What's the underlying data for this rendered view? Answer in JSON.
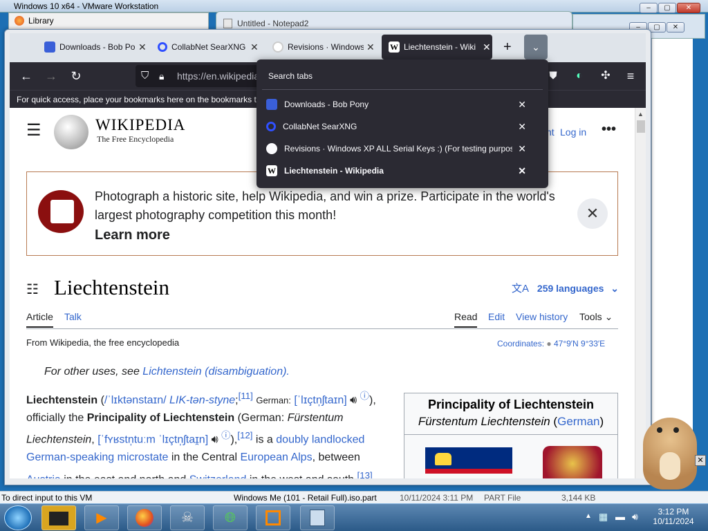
{
  "vmware": {
    "title": "Windows 10 x64 - VMware Workstation",
    "status": "To direct input to this VM"
  },
  "library": {
    "title": "Library"
  },
  "notepad": {
    "title": "Untitled - Notepad2"
  },
  "explorer_row": {
    "name": "Windows Me (101 - Retail Full).iso.part",
    "date": "10/11/2024 3:11 PM",
    "type": "PART File",
    "size": "3,144 KB"
  },
  "tabs": [
    {
      "label": "Downloads - Bob Po",
      "icon": "downloads-favicon"
    },
    {
      "label": "CollabNet SearXNG",
      "icon": "search-favicon"
    },
    {
      "label": "Revisions · Windows",
      "icon": "github-favicon"
    },
    {
      "label": "Liechtenstein - Wiki",
      "icon": "wikipedia-favicon"
    }
  ],
  "url": "https://en.wikipedia.org",
  "bookmarks_hint": "For quick access, place your bookmarks here on the bookmarks to",
  "search_tabs": {
    "heading": "Search tabs",
    "items": [
      {
        "label": "Downloads - Bob Pony",
        "bold": false
      },
      {
        "label": "CollabNet SearXNG",
        "bold": false
      },
      {
        "label": "Revisions · Windows XP ALL Serial Keys :) (For testing purpos...",
        "bold": false
      },
      {
        "label": "Liechtenstein - Wikipedia",
        "bold": true
      }
    ]
  },
  "wiki": {
    "brand": "WIKIPEDIA",
    "tagline": "The Free Encyclopedia",
    "account_partial": "nt",
    "login": "Log in",
    "banner_text": "Photograph a historic site, help Wikipedia, and win a prize. Participate in the world's largest photography competition this month!",
    "banner_cta": "Learn more",
    "page_title": "Liechtenstein",
    "languages": "259 languages",
    "tab_article": "Article",
    "tab_talk": "Talk",
    "tab_read": "Read",
    "tab_edit": "Edit",
    "tab_history": "View history",
    "tab_tools": "Tools",
    "from": "From Wikipedia, the free encyclopedia",
    "coords_label": "Coordinates:",
    "coords_value": "47°9′N 9°33′E",
    "hatnote_prefix": "For other uses, see ",
    "hatnote_link": "Lichtenstein (disambiguation).",
    "infobox_title": "Principality of Liechtenstein",
    "infobox_native": "Fürstentum Liechtenstein",
    "infobox_lang": "German"
  },
  "clock": {
    "time": "3:12 PM",
    "date": "10/11/2024"
  }
}
